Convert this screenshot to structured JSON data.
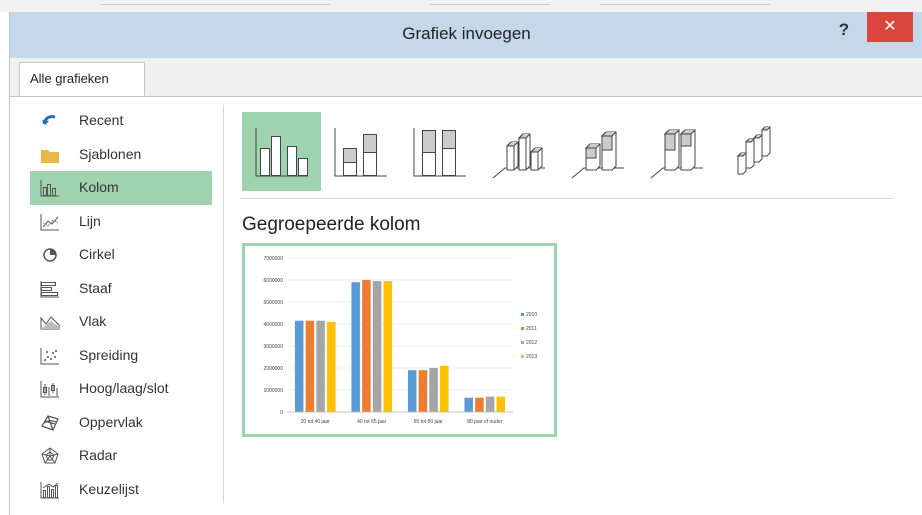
{
  "window": {
    "title": "Grafiek invoegen",
    "help_label": "?",
    "close_label": "✕"
  },
  "tabs": [
    {
      "label": "Alle grafieken"
    }
  ],
  "sidebar": {
    "items": [
      {
        "label": "Recent",
        "icon": "recent-icon"
      },
      {
        "label": "Sjablonen",
        "icon": "folder-icon"
      },
      {
        "label": "Kolom",
        "icon": "column-chart-icon",
        "selected": true
      },
      {
        "label": "Lijn",
        "icon": "line-chart-icon"
      },
      {
        "label": "Cirkel",
        "icon": "pie-chart-icon"
      },
      {
        "label": "Staaf",
        "icon": "bar-chart-icon"
      },
      {
        "label": "Vlak",
        "icon": "area-chart-icon"
      },
      {
        "label": "Spreiding",
        "icon": "scatter-chart-icon"
      },
      {
        "label": "Hoog/laag/slot",
        "icon": "stock-chart-icon"
      },
      {
        "label": "Oppervlak",
        "icon": "surface-chart-icon"
      },
      {
        "label": "Radar",
        "icon": "radar-chart-icon"
      },
      {
        "label": "Keuzelijst",
        "icon": "combo-chart-icon"
      }
    ]
  },
  "subtypes": [
    {
      "icon": "clustered-column-icon",
      "selected": true
    },
    {
      "icon": "stacked-column-icon"
    },
    {
      "icon": "100-stacked-column-icon"
    },
    {
      "icon": "3d-clustered-column-icon"
    },
    {
      "icon": "3d-stacked-column-icon"
    },
    {
      "icon": "3d-100-stacked-column-icon"
    },
    {
      "icon": "3d-column-icon"
    }
  ],
  "selected_subtype_name": "Gegroepeerde kolom",
  "colors": {
    "accent": "#9fd3b0",
    "titlebar": "#c4d8ea",
    "close": "#d9463e"
  },
  "chart_data": {
    "type": "bar",
    "categories": [
      "20 tot 40 jaar",
      "40 tot 65 jaar",
      "65 tot 80 jaar",
      "80 jaar of ouder"
    ],
    "series": [
      {
        "name": "2010",
        "color": "#5b9bd5",
        "values": [
          4150000,
          5900000,
          1900000,
          650000
        ]
      },
      {
        "name": "2011",
        "color": "#ed7d31",
        "values": [
          4150000,
          6000000,
          1900000,
          650000
        ]
      },
      {
        "name": "2012",
        "color": "#a5a5a5",
        "values": [
          4150000,
          5950000,
          2000000,
          700000
        ]
      },
      {
        "name": "2013",
        "color": "#ffc000",
        "values": [
          4100000,
          5950000,
          2100000,
          700000
        ]
      }
    ],
    "yticks": [
      "0",
      "1000000",
      "2000000",
      "3000000",
      "4000000",
      "5000000",
      "6000000",
      "7000000"
    ],
    "ylim": [
      0,
      7000000
    ],
    "grid": true,
    "legend_position": "right"
  }
}
